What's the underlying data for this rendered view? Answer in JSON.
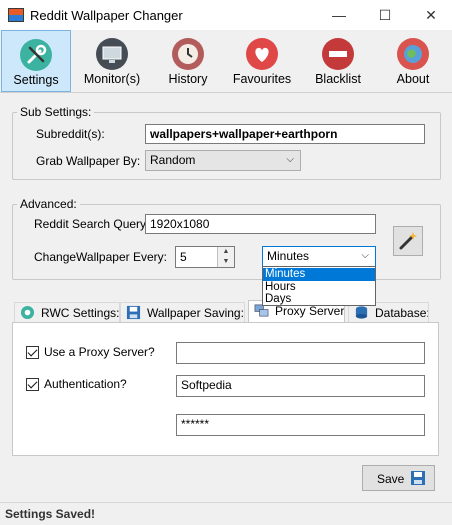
{
  "window": {
    "title": "Reddit Wallpaper Changer"
  },
  "toolbar": {
    "items": [
      {
        "label": "Settings",
        "icon": "wrench-screwdriver-icon",
        "active": true
      },
      {
        "label": "Monitor(s)",
        "icon": "monitor-icon"
      },
      {
        "label": "History",
        "icon": "clock-icon"
      },
      {
        "label": "Favourites",
        "icon": "heart-icon"
      },
      {
        "label": "Blacklist",
        "icon": "no-entry-icon"
      },
      {
        "label": "About",
        "icon": "globe-icon"
      }
    ]
  },
  "sub_settings": {
    "legend": "Sub Settings:",
    "subreddit_label": "Subreddit(s):",
    "subreddit_value": "wallpapers+wallpaper+earthporn",
    "grab_label": "Grab Wallpaper By:",
    "grab_value": "Random"
  },
  "advanced": {
    "legend": "Advanced:",
    "query_label": "Reddit Search Query:",
    "query_value": "1920x1080",
    "change_label": "ChangeWallpaper Every:",
    "change_value": "5",
    "unit_value": "Minutes",
    "unit_options": [
      "Minutes",
      "Hours",
      "Days"
    ]
  },
  "tabs": [
    {
      "label": "RWC Settings:",
      "icon": "gear-icon"
    },
    {
      "label": "Wallpaper Saving:",
      "icon": "floppy-icon"
    },
    {
      "label": "Proxy Server:",
      "icon": "network-icon",
      "active": true
    },
    {
      "label": "Database:",
      "icon": "database-icon"
    }
  ],
  "proxy": {
    "use_proxy_label": "Use a Proxy Server?",
    "use_proxy_checked": true,
    "proxy_value": "",
    "auth_label": "Authentication?",
    "auth_checked": true,
    "username_value": "Softpedia",
    "password_value": "******"
  },
  "save_button": {
    "label": "Save"
  },
  "status": {
    "text": "Settings Saved!"
  }
}
